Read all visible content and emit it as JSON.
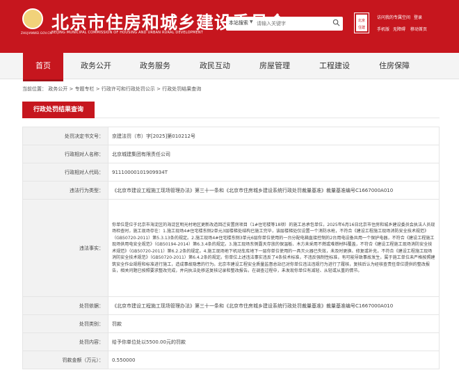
{
  "header": {
    "title": "北京市住房和城乡建设委员会",
    "title_en": "BEIJING MUNICIPAL COMMISSION OF HOUSING AND URBAN RURAL DEVELOPMENT",
    "logo_url_text": "ZHUJIANWEI.GOV.CN",
    "search": {
      "scope": "本站搜索",
      "placeholder": "请输入关键字"
    },
    "badge": {
      "line1": "北京",
      "line2": "住建"
    },
    "top_links": [
      "访问我的专属空间",
      "登录",
      "手机版",
      "无障碍",
      "移动首页"
    ]
  },
  "nav": {
    "items": [
      "首页",
      "政务公开",
      "政务服务",
      "政民互动",
      "房屋管理",
      "工程建设",
      "住房保障"
    ],
    "active": 0
  },
  "breadcrumb": {
    "prefix": "当前位置：",
    "items": [
      "政务公开",
      "专题专栏",
      "行政许可和行政处罚公示",
      "行政处罚结果查询"
    ]
  },
  "section": {
    "title": "行政处罚结果查询"
  },
  "record": {
    "rows": [
      {
        "label": "处罚决定书文号：",
        "value": "京建法罚（市）字[2025]第010212号"
      },
      {
        "label": "行政相对人名称：",
        "value": "北京城建集团有限责任公司"
      },
      {
        "label": "行政相对人代码：",
        "value": "91110000101909934T"
      },
      {
        "label": "违法行为类型：",
        "value": "《北京市建设工程施工现场管理办法》第三十一条和《北京市住房城乡建设系统行政处罚裁量基准》裁量基准编号C1667000A010"
      },
      {
        "label": "违法事实：",
        "value": "你单位是位于北京市海淀区的海淀区明光村地区更新改造回迁安置房项目（1#住宅楼等18项）的施工总承包单位，2025年6月16日北京市住房和城乡建设委员会执法人员现场检查时，施工现场存在：1.施工现场4#住宅楼东侧2单元3层楼梯处结构已施工完毕，该层楼梯处仅设置一个消防水枪，不符合《建设工程施工现场消防安全技术规范》（GB50720-2011）第5.3.13条的规定。2.施工现场4#住宅楼东侧3单元6层你单位使用的一台分配电箱直接控制的2台用电设备共用一个保护电器，不符合《建设工程施工现场供用电安全规范》（GB50194-2014）第6.3.4条的规定。3.施工现场东侧露天存放的保温板、木方未采用不燃或难燃材料覆盖，不符合《建设工程施工现场消防安全技术规范》（GB50720-2011）第6.2.2条的规定。4.施工现场地下机动车库地下一层你单位使用的一具灭火器已失效，未及时更换、修复或补充，不符合《建设工程施工现场消防安全技术规范》（GB50720-2011）第6.4.2条的规定。你单位上述违法事实违反了4条技术标准，不违反强制性标准，有可能导致事故发生，属于施工单位未严格按照建筑安全作业规程和标准进行施工，造成事故隐患的行为。北京市建设工程安全质量监督总站已对你单位违法违规行为进行了履核，复核后认为经核查责任单位提供的整改报告，相关问题已按照要求整改完成，并向执法处移送复核记录和整改报告。在调查过程中，未发现你单位有减轻、从轻或从重的情节。"
      },
      {
        "label": "处罚依据：",
        "value": "《北京市建设工程施工现场管理办法》第三十一条和《北京市住房城乡建设系统行政处罚裁量基准》裁量基准编号C1667000A010"
      },
      {
        "label": "处罚类别：",
        "value": "罚款"
      },
      {
        "label": "处罚内容：",
        "value": "给予你单位处以5500.00元的罚款"
      },
      {
        "label": "罚款金额（万元）：",
        "value": "0.550000"
      }
    ]
  },
  "colors": {
    "brand_red": "#c6161e",
    "label_bg": "#f2f2f2"
  }
}
